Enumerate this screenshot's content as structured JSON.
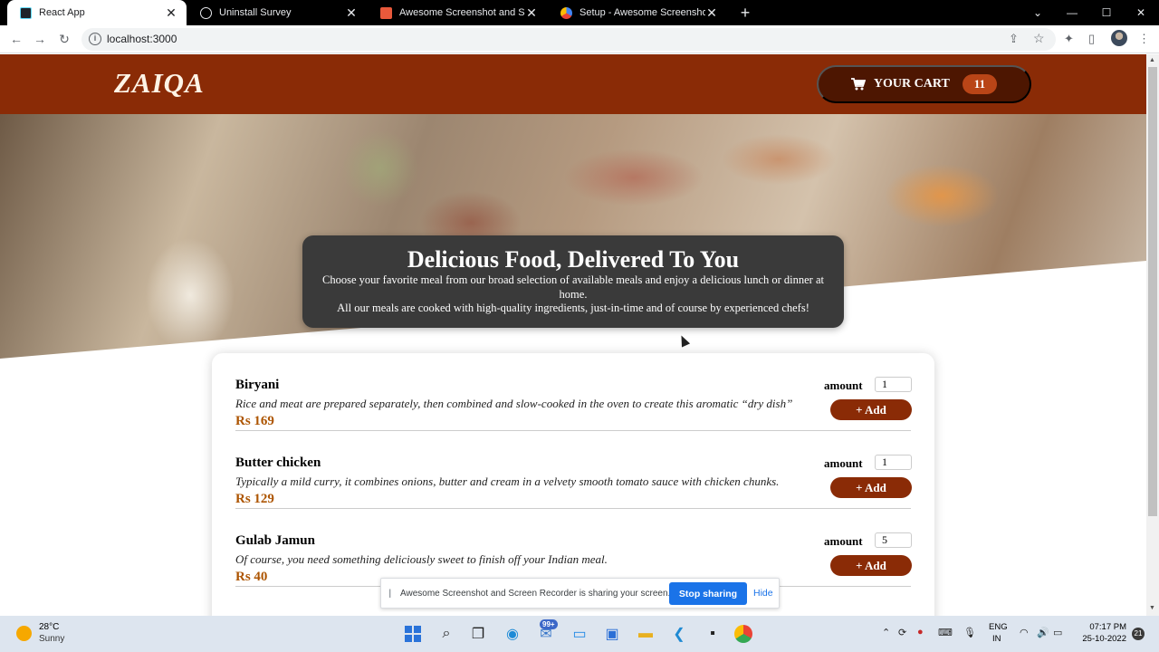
{
  "browser": {
    "tabs": [
      {
        "title": "React App",
        "active": true
      },
      {
        "title": "Uninstall Survey",
        "active": false
      },
      {
        "title": "Awesome Screenshot and Screen",
        "active": false
      },
      {
        "title": "Setup - Awesome Screenshot",
        "active": false
      }
    ],
    "url": "localhost:3000"
  },
  "header": {
    "logo": "ZAIQA",
    "cart_label": "YOUR CART",
    "cart_count": "11"
  },
  "hero": {
    "title": "Delicious Food, Delivered To You",
    "line1": "Choose your favorite meal from our broad selection of available meals and enjoy a delicious lunch or dinner at home.",
    "line2": "All our meals are cooked with high-quality ingredients, just-in-time and of course by experienced chefs!"
  },
  "meals": {
    "amount_label": "amount",
    "add_label": "+ Add",
    "items": [
      {
        "name": "Biryani",
        "description": "Rice and meat are prepared separately, then combined and slow-cooked in the oven to create this aromatic “dry dish”",
        "price": "Rs 169",
        "amount": "1"
      },
      {
        "name": "Butter chicken",
        "description": "Typically a mild curry, it combines onions, butter and cream in a velvety smooth tomato sauce with chicken chunks.",
        "price": "Rs 129",
        "amount": "1"
      },
      {
        "name": "Gulab Jamun",
        "description": "Of course, you need something deliciously sweet to finish off your Indian meal.",
        "price": "Rs 40",
        "amount": "5"
      }
    ]
  },
  "share_bar": {
    "message": "Awesome Screenshot and Screen Recorder is sharing your screen.",
    "stop_label": "Stop sharing",
    "hide_label": "Hide"
  },
  "taskbar": {
    "temperature": "28°C",
    "condition": "Sunny",
    "mail_badge": "99+",
    "lang_primary": "ENG",
    "lang_region": "IN",
    "time": "07:17 PM",
    "date": "25-10-2022",
    "notification_count": "21"
  },
  "colors": {
    "header": "#8a2b06",
    "cart_button": "#4d1601",
    "cart_badge": "#b94517",
    "price": "#ad5502",
    "add_button": "#8a2b06"
  }
}
